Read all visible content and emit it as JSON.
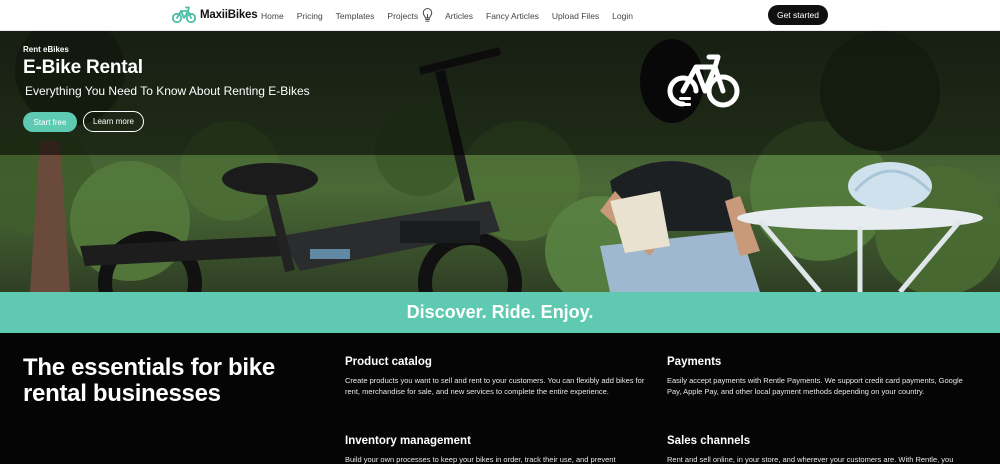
{
  "nav": {
    "brand": "MaxiiBikes",
    "links": [
      "Home",
      "Pricing",
      "Templates",
      "Projects",
      "Articles",
      "Fancy Articles",
      "Upload Files",
      "Login"
    ],
    "cta": "Get started"
  },
  "hero": {
    "eyebrow": "Rent eBikes",
    "title": "E-Bike Rental",
    "subtitle": "Everything You Need To Know About Renting E-Bikes",
    "primary_button": "Start free",
    "secondary_button": "Learn more"
  },
  "band": {
    "text": "Discover. Ride. Enjoy."
  },
  "features": {
    "heading": "The essentials for bike rental businesses",
    "items": [
      {
        "title": "Product catalog",
        "description": "Create products you want to sell and rent to your customers. You can flexibly add bikes for rent, merchandise for sale, and new services to complete the entire experience."
      },
      {
        "title": "Payments",
        "description": "Easily accept payments with Rentle Payments. We support credit card payments, Google Pay, Apple Pay, and other local payment methods depending on your country."
      },
      {
        "title": "Inventory management",
        "description": "Build your own processes to keep your bikes in order, track their use, and prevent"
      },
      {
        "title": "Sales channels",
        "description": "Rent and sell online, in your store, and wherever your customers are. With Rentle, you"
      }
    ]
  },
  "colors": {
    "accent": "#5fcab1",
    "dark": "#050505",
    "brand_icon": "#4bbfa6"
  }
}
